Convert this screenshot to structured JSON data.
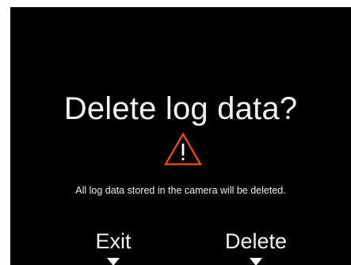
{
  "dialog": {
    "title": "Delete log data?",
    "warning_icon": "warning-triangle-icon",
    "message": "All log data stored in the camera will be deleted.",
    "accent_color": "#e04a1e",
    "background_color": "#000000"
  },
  "softkeys": {
    "exit_label": "Exit",
    "delete_label": "Delete"
  }
}
